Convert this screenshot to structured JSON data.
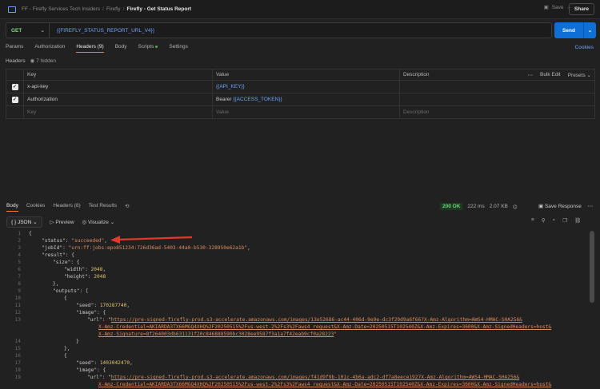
{
  "breadcrumb": {
    "workspace": "FF - Firefly Services Tech Insiders",
    "collection": "Firefly",
    "request": "Firefly - Get Status Report"
  },
  "topbar": {
    "save_label": "Save",
    "share_label": "Share"
  },
  "request": {
    "method": "GET",
    "url": "{{FIREFLY_STATUS_REPORT_URL_V4}}",
    "send_label": "Send"
  },
  "req_tabs": [
    "Params",
    "Authorization",
    "Headers (9)",
    "Body",
    "Scripts",
    "Settings"
  ],
  "cookies_label": "Cookies",
  "headers_section": {
    "title": "Headers",
    "hidden": "7 hidden",
    "bulk_edit": "Bulk Edit",
    "presets": "Presets"
  },
  "columns": {
    "key": "Key",
    "value": "Value",
    "description": "Description"
  },
  "headers": [
    {
      "key": "x-api-key",
      "value": "{{API_KEY}}",
      "value_prefix": ""
    },
    {
      "key": "Authorization",
      "value": "{{ACCESS_TOKEN}}",
      "value_prefix": "Bearer"
    }
  ],
  "placeholders": {
    "key": "Key",
    "value": "Value",
    "description": "Description"
  },
  "resp_tabs": [
    "Body",
    "Cookies",
    "Headers (8)",
    "Test Results"
  ],
  "status": {
    "code": "200 OK",
    "time": "222 ms",
    "size": "2.07 KB"
  },
  "save_response": "Save Response",
  "format": "JSON",
  "preview": "Preview",
  "visualize": "Visualize",
  "lines": [
    "1",
    "2",
    "3",
    "4",
    "5",
    "6",
    "7",
    "8",
    "9",
    "10",
    "11",
    "12",
    "13",
    "",
    "",
    "14",
    "15",
    "16",
    "17",
    "18",
    "19"
  ],
  "code": {
    "l1": "{",
    "status_val": "\"succeeded\"",
    "jobid_val": "\"urn:ff:jobs:epo851234:726d36ad-5403-44a0-b530-328950e62a1b\"",
    "width_val": "2048",
    "height_val": "2048",
    "seed1": "170287740",
    "url1a": "https://pre-signed-firefly-prod.s3-accelerate.amazonaws.com/images/13e52686-ac44-406d-9e9e-dc3f29d9a6f66?X-Amz-Algorithm=AWS4-HMAC-SHA256&",
    "url1b": "X-Amz-Credential=AKIARDA3TX66MGQ4XHQ%2F20250515%2Fus-west-2%2Fs3%2Faws4_request&X-Amz-Date=20250515T102540Z&X-Amz-Expires=3600&X-Amz-SignedHeaders=host&",
    "url1c": "X-Amz-Signature=8f264003db631131f20c846888590bc3028ee9587f3a1a7f42eab9cf0a28223",
    "seed2": "1403042470",
    "url2a": "https://pre-signed-firefly-prod.s3-accelerate.amazonaws.com/images/f41d9f9b-101c-4b6a-adc2-df7a8eece1927X-Amz-Algorithm=AWS4-HMAC-SHA256&",
    "url2b": "X-Amz-Credential=AKIARDA3TX66MGQ4XHQ%2F20250515%2Fus-west-2%2Fs3%2Faws4_request&X-Amz-Date=20250515T102540Z&X-Amz-Expires=3600&X-Amz-SignedHeaders=host&"
  }
}
